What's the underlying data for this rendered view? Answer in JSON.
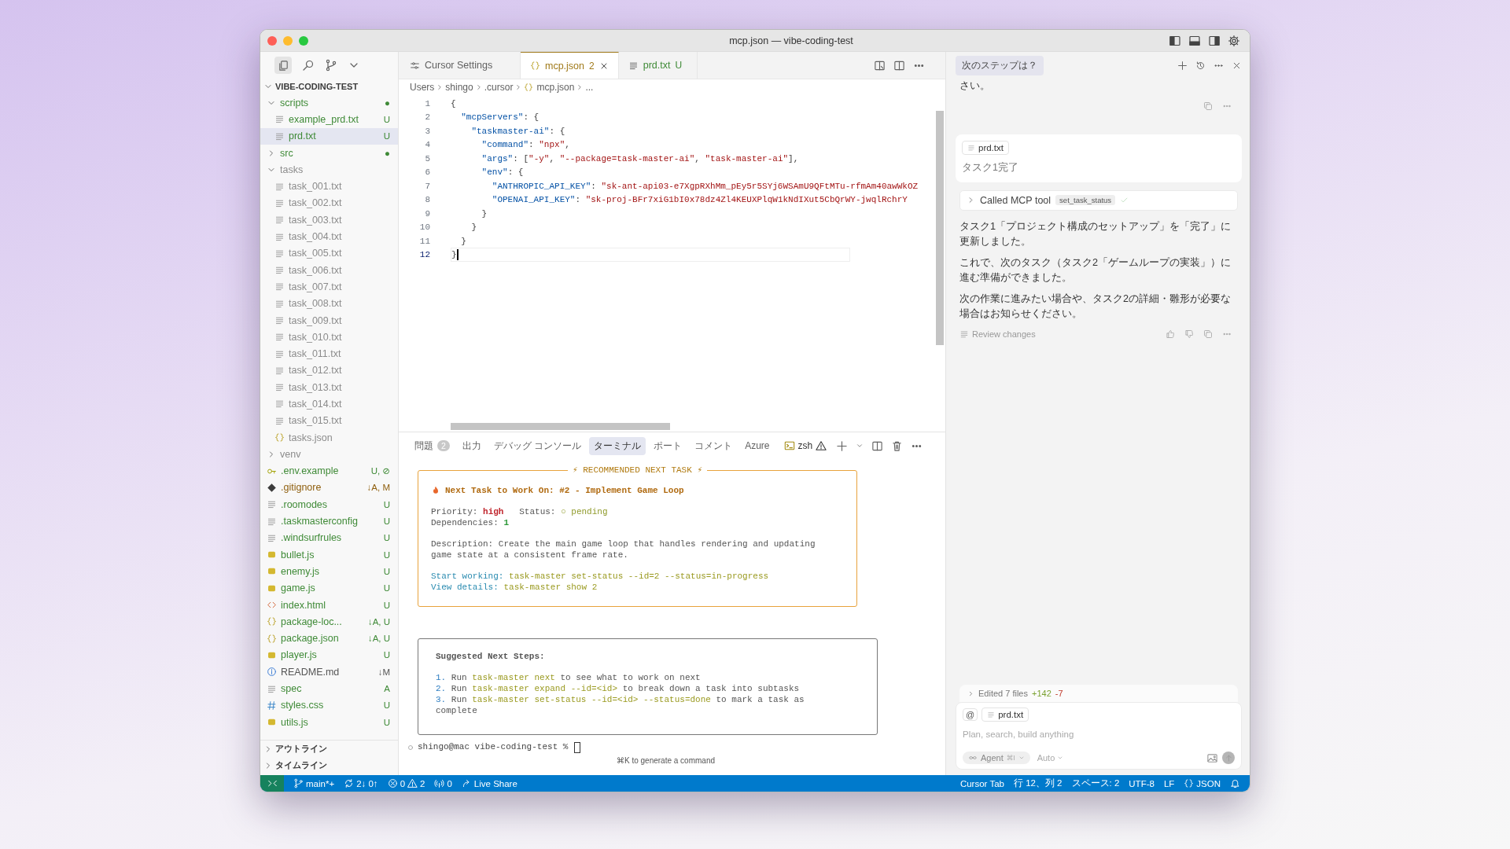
{
  "window": {
    "title": "mcp.json — vibe-coding-test"
  },
  "explorer": {
    "title": "VIBE-CODING-TEST",
    "expanded": true,
    "items": [
      {
        "name": "scripts",
        "kind": "folder",
        "color": "#3f8a37",
        "badge": "●",
        "expanded": true,
        "selected": false,
        "children": [
          {
            "name": "example_prd.txt",
            "kind": "txt",
            "color": "#3f8a37",
            "badge": "U",
            "selected": false
          },
          {
            "name": "prd.txt",
            "kind": "txt",
            "color": "#3f8a37",
            "badge": "U",
            "selected": true
          }
        ]
      },
      {
        "name": "src",
        "kind": "folder",
        "color": "#3f8a37",
        "badge": "●",
        "expanded": false,
        "selected": false
      },
      {
        "name": "tasks",
        "kind": "folder",
        "color": "#8c8c8c",
        "expanded": true,
        "selected": false,
        "children": [
          {
            "name": "task_001.txt",
            "kind": "txt",
            "color": "#8c8c8c",
            "selected": false
          },
          {
            "name": "task_002.txt",
            "kind": "txt",
            "color": "#8c8c8c",
            "selected": false
          },
          {
            "name": "task_003.txt",
            "kind": "txt",
            "color": "#8c8c8c",
            "selected": false
          },
          {
            "name": "task_004.txt",
            "kind": "txt",
            "color": "#8c8c8c",
            "selected": false
          },
          {
            "name": "task_005.txt",
            "kind": "txt",
            "color": "#8c8c8c",
            "selected": false
          },
          {
            "name": "task_006.txt",
            "kind": "txt",
            "color": "#8c8c8c",
            "selected": false
          },
          {
            "name": "task_007.txt",
            "kind": "txt",
            "color": "#8c8c8c",
            "selected": false
          },
          {
            "name": "task_008.txt",
            "kind": "txt",
            "color": "#8c8c8c",
            "selected": false
          },
          {
            "name": "task_009.txt",
            "kind": "txt",
            "color": "#8c8c8c",
            "selected": false
          },
          {
            "name": "task_010.txt",
            "kind": "txt",
            "color": "#8c8c8c",
            "selected": false
          },
          {
            "name": "task_011.txt",
            "kind": "txt",
            "color": "#8c8c8c",
            "selected": false
          },
          {
            "name": "task_012.txt",
            "kind": "txt",
            "color": "#8c8c8c",
            "selected": false
          },
          {
            "name": "task_013.txt",
            "kind": "txt",
            "color": "#8c8c8c",
            "selected": false
          },
          {
            "name": "task_014.txt",
            "kind": "txt",
            "color": "#8c8c8c",
            "selected": false
          },
          {
            "name": "task_015.txt",
            "kind": "txt",
            "color": "#8c8c8c",
            "selected": false
          },
          {
            "name": "tasks.json",
            "kind": "json",
            "color": "#8c8c8c",
            "selected": false
          }
        ]
      },
      {
        "name": "venv",
        "kind": "folder",
        "color": "#8c8c8c",
        "expanded": false,
        "selected": false
      },
      {
        "name": ".env.example",
        "kind": "env",
        "color": "#3f8a37",
        "badge": "U, ⊘",
        "selected": false
      },
      {
        "name": ".gitignore",
        "kind": "git",
        "color": "#8f5f0e",
        "badge": "↓A, M",
        "selected": false
      },
      {
        "name": ".roomodes",
        "kind": "txt",
        "color": "#3f8a37",
        "badge": "U",
        "selected": false
      },
      {
        "name": ".taskmasterconfig",
        "kind": "txt",
        "color": "#3f8a37",
        "badge": "U",
        "selected": false
      },
      {
        "name": ".windsurfrules",
        "kind": "txt",
        "color": "#3f8a37",
        "badge": "U",
        "selected": false
      },
      {
        "name": "bullet.js",
        "kind": "js",
        "color": "#3f8a37",
        "badge": "U",
        "selected": false
      },
      {
        "name": "enemy.js",
        "kind": "js",
        "color": "#3f8a37",
        "badge": "U",
        "selected": false
      },
      {
        "name": "game.js",
        "kind": "js",
        "color": "#3f8a37",
        "badge": "U",
        "selected": false
      },
      {
        "name": "index.html",
        "kind": "html",
        "color": "#3f8a37",
        "badge": "U",
        "selected": false
      },
      {
        "name": "package-loc...",
        "kind": "json",
        "color": "#3f8a37",
        "badge": "↓A, U",
        "selected": false
      },
      {
        "name": "package.json",
        "kind": "json",
        "color": "#3f8a37",
        "badge": "↓A, U",
        "selected": false
      },
      {
        "name": "player.js",
        "kind": "js",
        "color": "#3f8a37",
        "badge": "U",
        "selected": false
      },
      {
        "name": "README.md",
        "kind": "info",
        "color": "#555555",
        "badge": "↓M",
        "selected": false
      },
      {
        "name": "spec",
        "kind": "txt",
        "color": "#3f8a37",
        "badge": "A",
        "selected": false
      },
      {
        "name": "styles.css",
        "kind": "css",
        "color": "#3f8a37",
        "badge": "U",
        "selected": false
      },
      {
        "name": "utils.js",
        "kind": "js",
        "color": "#3f8a37",
        "badge": "U",
        "selected": false
      }
    ]
  },
  "explorer_sections": [
    {
      "label": "アウトライン",
      "expanded": false
    },
    {
      "label": "タイムライン",
      "expanded": false
    }
  ],
  "editor_tabs": [
    {
      "label": "Cursor Settings",
      "kind": "settings",
      "selected": false
    },
    {
      "label": "mcp.json",
      "kind": "json",
      "badge": "2",
      "selected": true
    },
    {
      "label": "prd.txt",
      "kind": "txt",
      "badge": "U",
      "selected": false
    }
  ],
  "breadcrumbs": [
    {
      "label": "Users",
      "kind": "folder"
    },
    {
      "label": "shingo",
      "kind": "folder"
    },
    {
      "label": ".cursor",
      "kind": "folder"
    },
    {
      "label": "mcp.json",
      "kind": "json"
    },
    {
      "label": "...",
      "kind": "more"
    }
  ],
  "code": [
    {
      "number": "1",
      "current": false,
      "text": "{"
    },
    {
      "number": "2",
      "current": false,
      "text": "  \"mcpServers\": {"
    },
    {
      "number": "3",
      "current": false,
      "text": "    \"taskmaster-ai\": {"
    },
    {
      "number": "4",
      "current": false,
      "text": "      \"command\": \"npx\","
    },
    {
      "number": "5",
      "current": false,
      "text": "      \"args\": [\"-y\", \"--package=task-master-ai\", \"task-master-ai\"],"
    },
    {
      "number": "6",
      "current": false,
      "text": "      \"env\": {"
    },
    {
      "number": "7",
      "current": false,
      "text": "        \"ANTHROPIC_API_KEY\": \"sk-ant-api03-e7XgpRXhMm_pEy5r5SYj6WSAmU9QFtMTu-rfmAm40awWkOZ"
    },
    {
      "number": "8",
      "current": false,
      "text": "        \"OPENAI_API_KEY\": \"sk-proj-BFr7xiG1bI0x78dz4Zl4KEUXPlqW1kNdIXut5CbQrWY-jwqlRchrY"
    },
    {
      "number": "9",
      "current": false,
      "text": "      }"
    },
    {
      "number": "10",
      "current": false,
      "text": "    }"
    },
    {
      "number": "11",
      "current": false,
      "text": "  }"
    },
    {
      "number": "12",
      "current": true,
      "text": "}"
    }
  ],
  "panel": {
    "tabs": [
      {
        "label": "問題",
        "badge": "2",
        "selected": false
      },
      {
        "label": "出力",
        "selected": false
      },
      {
        "label": "デバッグ コンソール",
        "selected": false
      },
      {
        "label": "ターミナル",
        "selected": true
      },
      {
        "label": "ポート",
        "selected": false
      },
      {
        "label": "コメント",
        "selected": false
      },
      {
        "label": "Azure",
        "selected": false
      }
    ],
    "shell": "zsh",
    "recommendation": {
      "title": "⚡ RECOMMENDED NEXT TASK ⚡",
      "heading": "Next Task to Work On: #2 - Implement Game Loop",
      "priority": {
        "label": "Priority:",
        "value": "high"
      },
      "status": {
        "label": "Status:",
        "value": "○ pending"
      },
      "dependencies": {
        "label": "Dependencies:",
        "value": "1"
      },
      "description": "Description: Create the main game loop that handles rendering and updating game state at a consistent frame rate.",
      "commands": [
        {
          "label": "Start working:",
          "command": "task-master set-status --id=2 --status=in-progress"
        },
        {
          "label": "View details:",
          "command": "task-master show 2"
        }
      ]
    },
    "next_steps": {
      "title": "Suggested Next Steps:",
      "steps": [
        {
          "number": "1.",
          "verb": "Run",
          "command": "task-master next",
          "rest": "to see what to work on next"
        },
        {
          "number": "2.",
          "verb": "Run",
          "command": "task-master expand --id=<id>",
          "rest": "to break down a task into subtasks"
        },
        {
          "number": "3.",
          "verb": "Run",
          "command": "task-master set-status --id=<id> --status=done",
          "rest": "to mark a task as complete"
        }
      ]
    },
    "prompt": "shingo@mac vibe-coding-test %",
    "hint": "⌘K to generate a command"
  },
  "chat": {
    "title": "次のステップは？",
    "messages": [
      {
        "kind": "assistant",
        "paragraphs": [
          "さい。"
        ]
      },
      {
        "kind": "user",
        "attachment": "prd.txt",
        "text": "タスク1完了"
      },
      {
        "kind": "tool_call",
        "label": "Called MCP tool",
        "tool": "set_task_status",
        "expanded": false,
        "done": true
      },
      {
        "kind": "assistant",
        "paragraphs": [
          "タスク1「プロジェクト構成のセットアップ」を「完了」に更新しました。",
          "これで、次のタスク（タスク2「ゲームループの実装」）に進む準備ができました。",
          "次の作業に進みたい場合や、タスク2の詳細・雛形が必要な場合はお知らせください。"
        ],
        "review": "Review changes"
      }
    ],
    "edits": {
      "label": "Edited 7 files",
      "added": "+142",
      "removed": "-7",
      "expanded": false
    },
    "composer": {
      "mention": "@",
      "context": "prd.txt",
      "placeholder": "Plan, search, build anything",
      "mode": "Agent",
      "shortcut": "⌘I",
      "model": "Auto"
    }
  },
  "status_bar": {
    "left": [
      {
        "kind": "remote"
      },
      {
        "kind": "branch",
        "text": "main*+"
      },
      {
        "kind": "sync",
        "text": "2↓ 0↑"
      },
      {
        "kind": "problems",
        "errors": "0",
        "warnings": "2"
      },
      {
        "kind": "ports",
        "text": "0"
      },
      {
        "kind": "share",
        "text": "Live Share"
      }
    ],
    "right": [
      {
        "kind": "text",
        "text": "Cursor Tab"
      },
      {
        "kind": "text",
        "text": "行 12、列 2"
      },
      {
        "kind": "text",
        "text": "スペース: 2"
      },
      {
        "kind": "text",
        "text": "UTF-8"
      },
      {
        "kind": "text",
        "text": "LF"
      },
      {
        "kind": "language",
        "text": "JSON"
      },
      {
        "kind": "bell"
      }
    ]
  }
}
